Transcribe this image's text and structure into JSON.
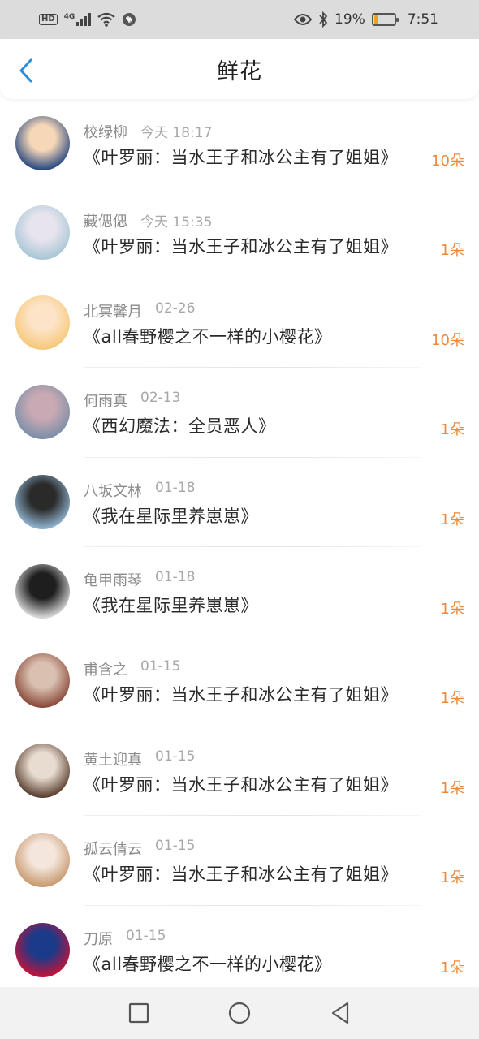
{
  "status_bar": {
    "hd": "HD",
    "network": "4G",
    "battery_percent": "19%",
    "time": "7:51",
    "battery_level": 0.19,
    "battery_color": "#f0a020"
  },
  "header": {
    "title": "鲜花",
    "back_icon": "chevron-left-icon",
    "accent": "#2a8ee0"
  },
  "items": [
    {
      "user": "校绿柳",
      "time": "今天 18:17",
      "book": "《叶罗丽：当水王子和冰公主有了姐姐》",
      "flowers": "10朵",
      "avatar_colors": [
        "#2b4a80",
        "#f6d7b8"
      ]
    },
    {
      "user": "藏偲偲",
      "time": "今天 15:35",
      "book": "《叶罗丽：当水王子和冰公主有了姐姐》",
      "flowers": "1朵",
      "avatar_colors": [
        "#a9c7d6",
        "#e8e4ee"
      ]
    },
    {
      "user": "北冥馨月",
      "time": "02-26",
      "book": "《all春野樱之不一样的小樱花》",
      "flowers": "10朵",
      "avatar_colors": [
        "#f6c87a",
        "#fde4c8"
      ]
    },
    {
      "user": "何雨真",
      "time": "02-13",
      "book": "《西幻魔法：全员恶人》",
      "flowers": "1朵",
      "avatar_colors": [
        "#7c8fa8",
        "#c9a9b3"
      ]
    },
    {
      "user": "八坂文林",
      "time": "01-18",
      "book": "《我在星际里养崽崽》",
      "flowers": "1朵",
      "avatar_colors": [
        "#8fb3cf",
        "#2a2a2a"
      ]
    },
    {
      "user": "龟甲雨琴",
      "time": "01-18",
      "book": "《我在星际里养崽崽》",
      "flowers": "1朵",
      "avatar_colors": [
        "#d8d8d8",
        "#1e1e1e"
      ]
    },
    {
      "user": "甫含之",
      "time": "01-15",
      "book": "《叶罗丽：当水王子和冰公主有了姐姐》",
      "flowers": "1朵",
      "avatar_colors": [
        "#8a4a3a",
        "#d9c0b0"
      ]
    },
    {
      "user": "黄土迎真",
      "time": "01-15",
      "book": "《叶罗丽：当水王子和冰公主有了姐姐》",
      "flowers": "1朵",
      "avatar_colors": [
        "#5a4030",
        "#e8dcd0"
      ]
    },
    {
      "user": "孤云倩云",
      "time": "01-15",
      "book": "《叶罗丽：当水王子和冰公主有了姐姐》",
      "flowers": "1朵",
      "avatar_colors": [
        "#c89a70",
        "#f4e6dc"
      ]
    },
    {
      "user": "刀原",
      "time": "01-15",
      "book": "《all春野樱之不一样的小樱花》",
      "flowers": "1朵",
      "avatar_colors": [
        "#c0143a",
        "#1a3a8a"
      ]
    }
  ],
  "nav": {
    "icons": [
      "recent-apps-icon",
      "home-icon",
      "back-icon"
    ]
  }
}
